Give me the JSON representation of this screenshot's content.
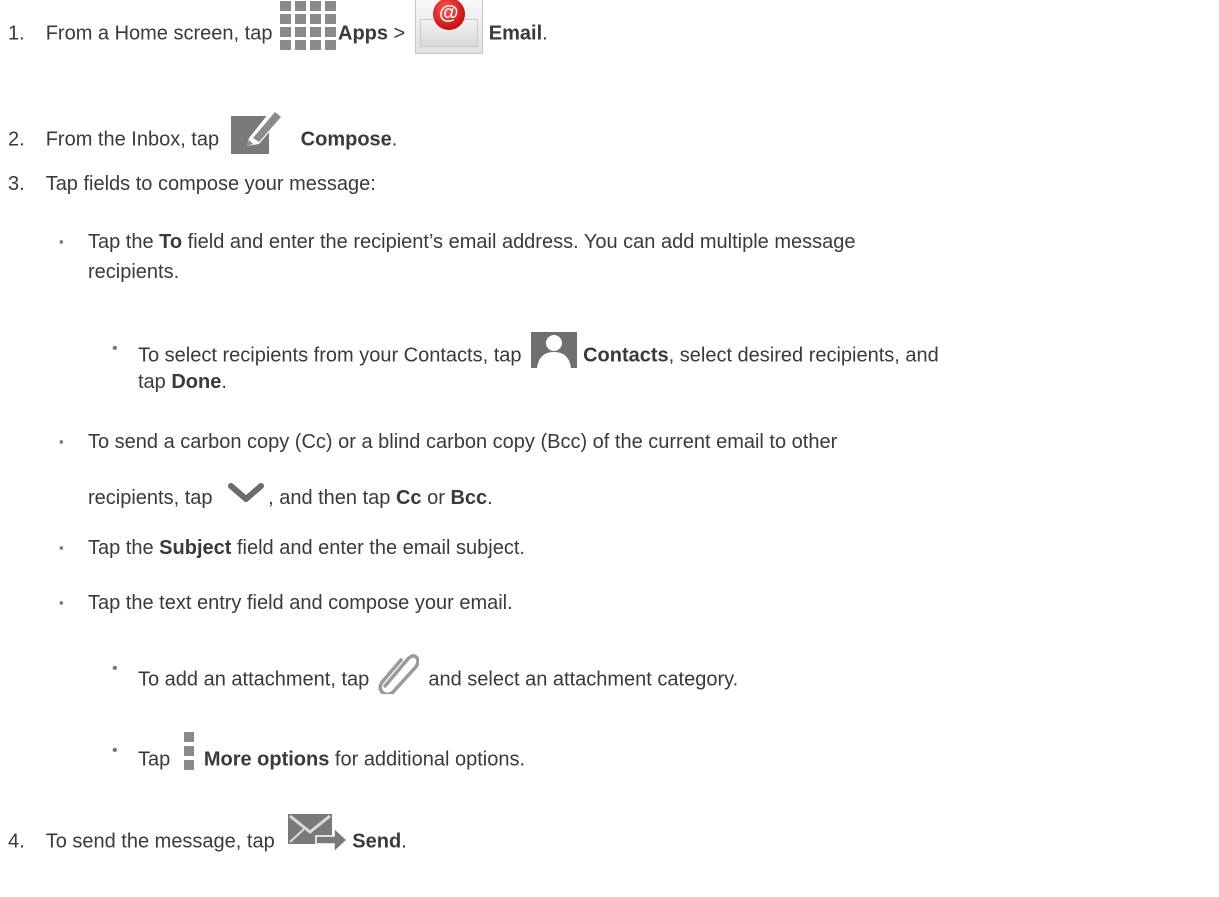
{
  "steps": [
    {
      "num": "1.",
      "t1": "From a Home screen, tap ",
      "b1": "Apps",
      "t2": " > ",
      "b2": "Email",
      "t3": "."
    },
    {
      "num": "2.",
      "t1": "From the Inbox, tap ",
      "b1": "Compose",
      "t2": "."
    },
    {
      "num": "3.",
      "t1": "Tap fields to compose your message:"
    },
    {
      "num": "4.",
      "t1": "To send the message, tap ",
      "b1": "Send",
      "t2": "."
    }
  ],
  "bullets": {
    "to": {
      "t1": "Tap the ",
      "b1": "To",
      "t2": " field and enter the recipient’s email address. You can add multiple message",
      "t3": "recipients."
    },
    "contacts": {
      "t1": "To select recipients from your Contacts, tap ",
      "b1": "Contacts",
      "t2": ", select desired recipients, and",
      "t3": "tap ",
      "b2": "Done",
      "t4": "."
    },
    "cc": {
      "t1": "To send a carbon copy (Cc) or a blind carbon copy (Bcc) of the current email to other",
      "t2": "recipients, tap ",
      "t3": ", and then tap ",
      "b1": "Cc",
      "t4": " or ",
      "b2": "Bcc",
      "t5": "."
    },
    "subject": {
      "t1": "Tap the ",
      "b1": "Subject",
      "t2": " field and enter the email subject."
    },
    "text": {
      "t1": "Tap the text entry field and compose your email."
    },
    "attach": {
      "t1": "To add an attachment, tap ",
      "t2": " and select an attachment category."
    },
    "more": {
      "t1": "Tap ",
      "b1": "More options",
      "t2": " for additional options."
    }
  },
  "markers": {
    "square": "▪",
    "dot": "•"
  },
  "icons": [
    "apps-grid-icon",
    "email-app-icon",
    "compose-icon",
    "contacts-icon",
    "chevron-down-icon",
    "paperclip-icon",
    "more-options-icon",
    "send-icon"
  ]
}
